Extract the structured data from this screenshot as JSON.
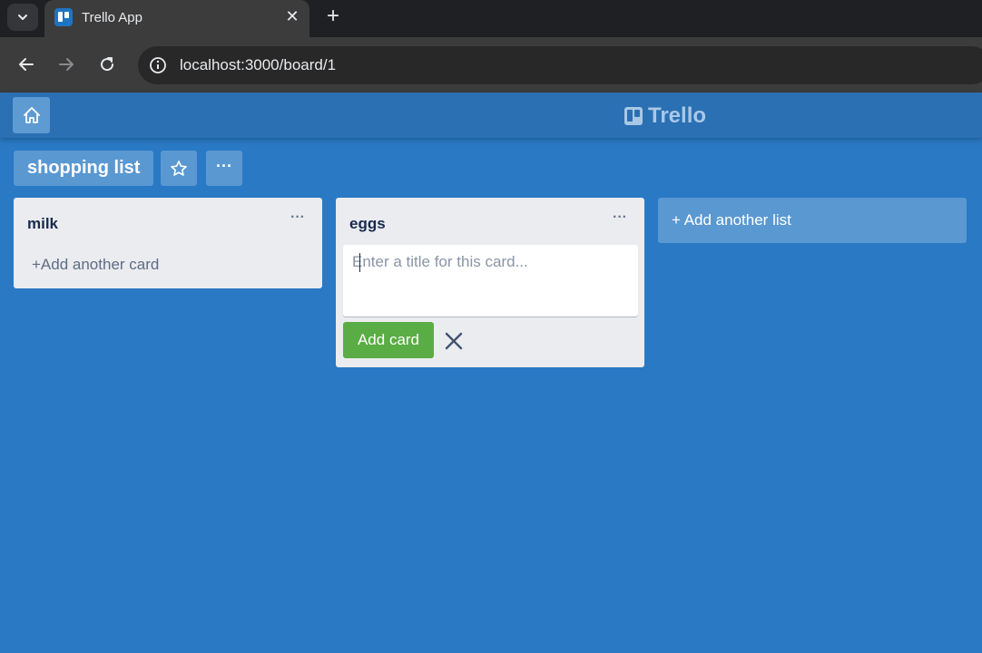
{
  "browser": {
    "tab_title": "Trello App",
    "url": "localhost:3000/board/1"
  },
  "app": {
    "brand": "Trello"
  },
  "board": {
    "title": "shopping list",
    "more_label": "···"
  },
  "lists": [
    {
      "title": "milk",
      "menu_label": "···",
      "add_card_label": "+Add another card"
    },
    {
      "title": "eggs",
      "menu_label": "···",
      "card_placeholder": "Enter a title for this card...",
      "add_card_button": "Add card"
    }
  ],
  "add_list_label": "+  Add another list",
  "colors": {
    "board_bg": "#2979c4",
    "header_bg": "#2a70b3",
    "list_bg": "#ebecf0",
    "add_button": "#5aac44"
  }
}
